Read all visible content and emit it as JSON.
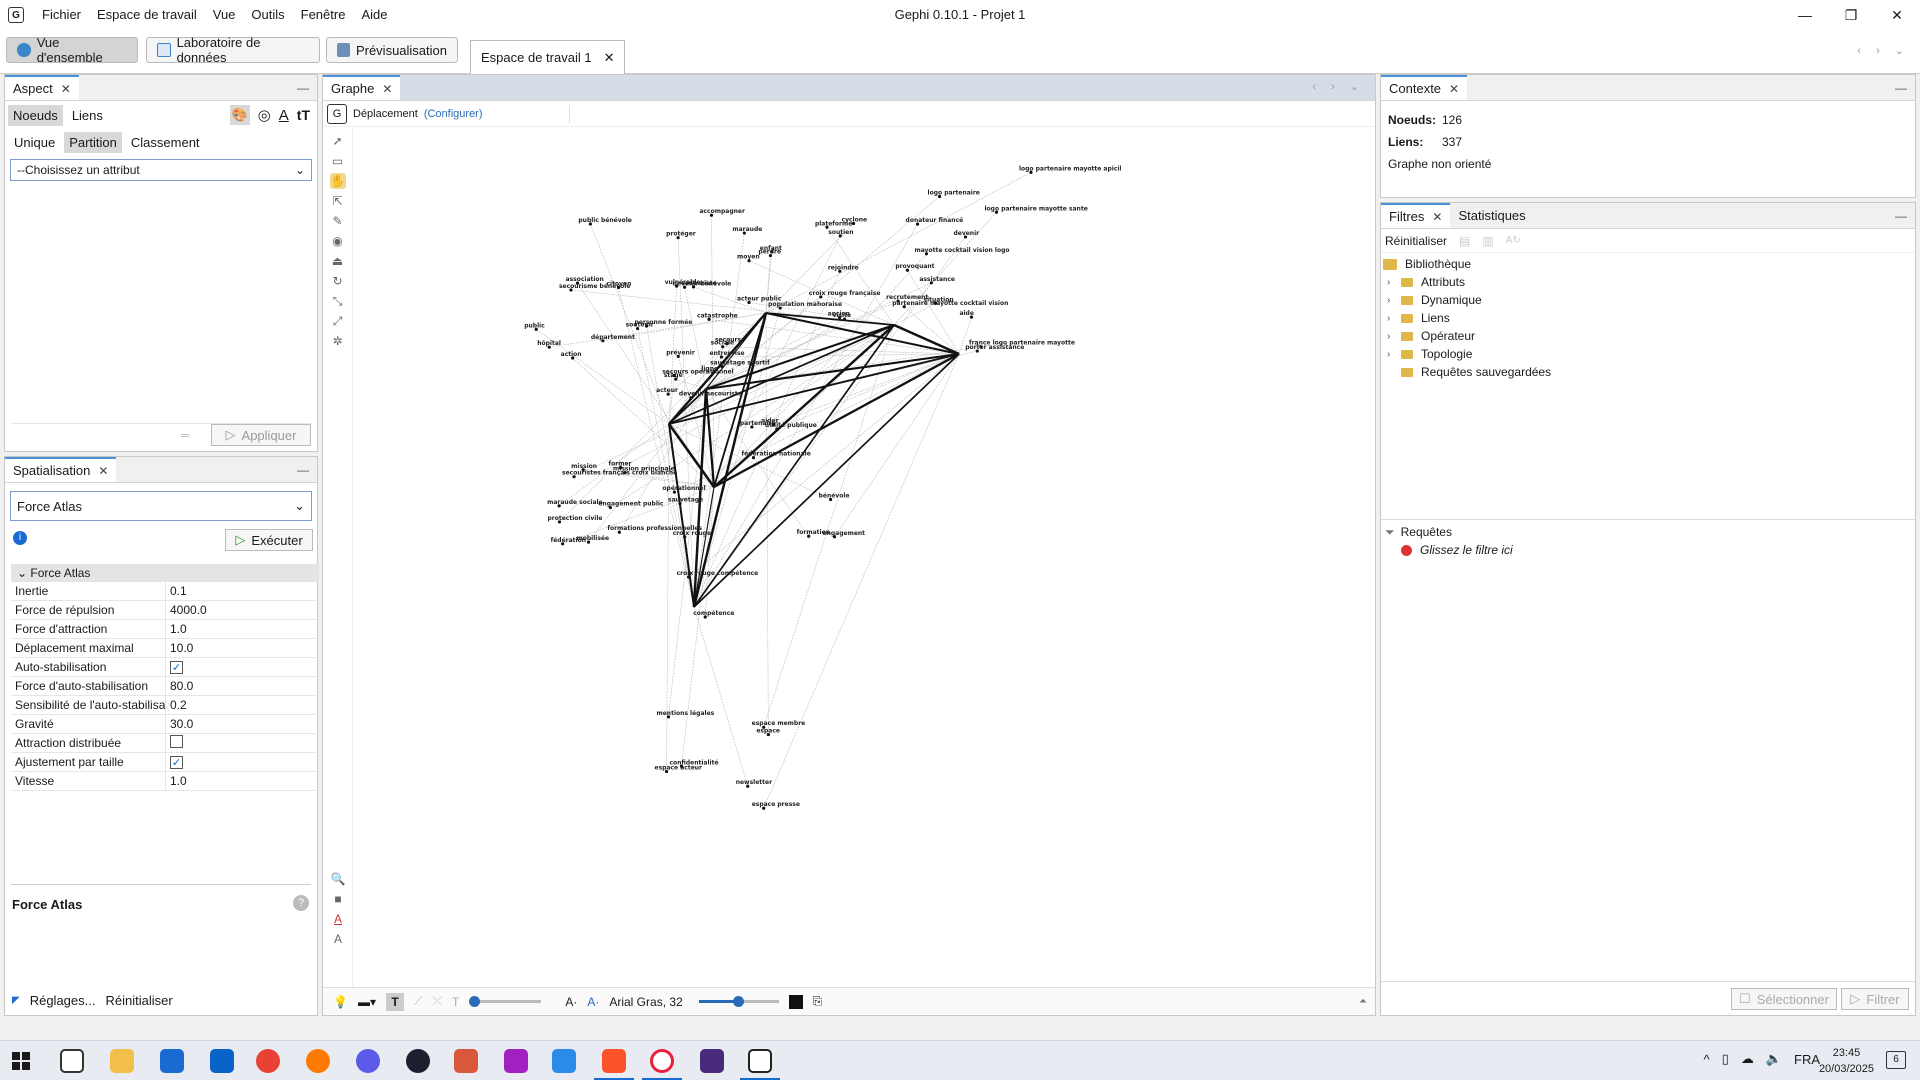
{
  "window": {
    "title": "Gephi 0.10.1 - Projet 1",
    "menu": [
      "Fichier",
      "Espace de travail",
      "Vue",
      "Outils",
      "Fenêtre",
      "Aide"
    ],
    "controls": [
      "—",
      "❐",
      "✕"
    ]
  },
  "toolbar": {
    "overview": "Vue d'ensemble",
    "data_lab": "Laboratoire de données",
    "preview": "Prévisualisation",
    "workspace_tab": "Espace de travail 1"
  },
  "aspect": {
    "tab": "Aspect",
    "nodes_tab": "Noeuds",
    "edges_tab": "Liens",
    "mode_unique": "Unique",
    "mode_partition": "Partition",
    "mode_classement": "Classement",
    "attribute_placeholder": "--Choisissez un attribut",
    "apply": "Appliquer"
  },
  "layout": {
    "tab": "Spatialisation",
    "algorithm": "Force Atlas",
    "run": "Exécuter",
    "section": "Force Atlas",
    "properties": [
      {
        "label": "Inertie",
        "value": "0.1"
      },
      {
        "label": "Force de répulsion",
        "value": "4000.0"
      },
      {
        "label": "Force d'attraction",
        "value": "1.0"
      },
      {
        "label": "Déplacement maximal",
        "value": "10.0"
      },
      {
        "label": "Auto-stabilisation",
        "checked": true
      },
      {
        "label": "Force d'auto-stabilisation",
        "value": "80.0"
      },
      {
        "label": "Sensibilité de l'auto-stabilisa",
        "value": "0.2"
      },
      {
        "label": "Gravité",
        "value": "30.0"
      },
      {
        "label": "Attraction distribuée",
        "checked": false
      },
      {
        "label": "Ajustement par taille",
        "checked": true
      },
      {
        "label": "Vitesse",
        "value": "1.0"
      }
    ],
    "description_title": "Force Atlas",
    "settings": "Réglages...",
    "reset": "Réinitialiser"
  },
  "graph": {
    "tab": "Graphe",
    "tool": "Déplacement",
    "configure": "(Configurer)",
    "font_label": "Arial Gras, 32",
    "nodes": [
      "devenir secouriste",
      "secourisme bénévole",
      "stage",
      "maraude sociale",
      "sociale",
      "mission principale",
      "maraude",
      "secouriste",
      "moyen",
      "ligne",
      "public bénévole",
      "engagement",
      "action",
      "rejoindre",
      "acteur",
      "acteur public",
      "mobilisée",
      "vulnérable",
      "catastrophe",
      "mission",
      "personne formée",
      "protection civile",
      "engagement public",
      "devenir bénévole",
      "secours",
      "utilité publique",
      "association",
      "protéger",
      "hôpital",
      "partenaire",
      "ancien",
      "secours opérationnel",
      "opérationnel",
      "prévenir",
      "citoyen",
      "enfant",
      "former",
      "formation",
      "bénévole",
      "aider",
      "accompagner",
      "soutenir",
      "département",
      "fédération nationale",
      "formations professionnelles",
      "public",
      "entreprise",
      "fédération",
      "sauvetage",
      "sauvetage sportif",
      "secouristes français croix blanche",
      "croix rouge française",
      "croix rouge",
      "croix rouge compétence",
      "compétence",
      "newsletter",
      "espace",
      "espace membre",
      "mentions légales",
      "espace acteur",
      "espace presse",
      "confidentialité",
      "donateur financé",
      "logo partenaire mayotte apicil",
      "logo partenaire mayotte sante",
      "france logo partenaire mayotte",
      "logo partenaire",
      "partenaire mayotte cocktail vision",
      "mayotte cocktail vision logo",
      "population mahoraise",
      "cyclone",
      "situation",
      "assistance",
      "porter assistance",
      "provoquant",
      "soutien",
      "devenir",
      "perdre",
      "plateforme",
      "recrutement",
      "visite",
      "aide"
    ]
  },
  "context": {
    "tab": "Contexte",
    "nodes_label": "Noeuds:",
    "nodes_value": "126",
    "edges_label": "Liens:",
    "edges_value": "337",
    "graph_type": "Graphe non orienté"
  },
  "filters": {
    "tab": "Filtres",
    "stats_tab": "Statistiques",
    "reset": "Réinitialiser",
    "library": "Bibliothèque",
    "items": [
      "Attributs",
      "Dynamique",
      "Liens",
      "Opérateur",
      "Topologie",
      "Requêtes sauvegardées"
    ],
    "queries": "Requêtes",
    "drop_hint": "Glissez le filtre ici",
    "select_btn": "Sélectionner",
    "filter_btn": "Filtrer"
  },
  "taskbar": {
    "lang": "FRA",
    "time": "23:45",
    "date": "20/03/2025",
    "notif": "6"
  },
  "colors": {
    "accent": "#4a90d9",
    "taskbar_indicator": "#1a6bd1"
  }
}
